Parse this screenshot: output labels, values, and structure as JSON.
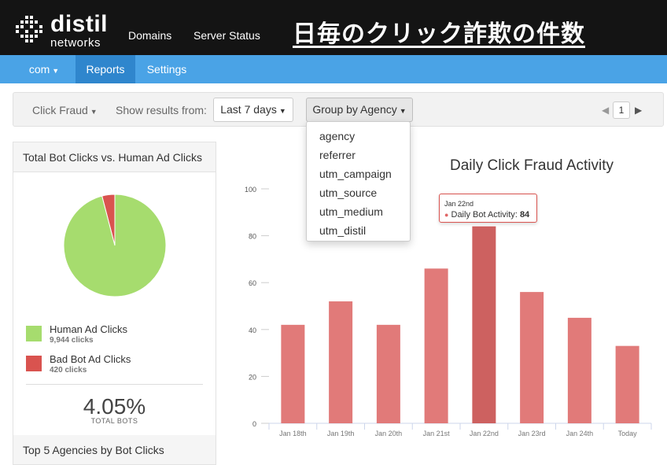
{
  "header": {
    "logo_word": "distil",
    "logo_sub": "networks",
    "nav": [
      "Domains",
      "Server Status"
    ],
    "overlay_title": "日毎のクリック詐欺の件数"
  },
  "subnav": {
    "domain": "com",
    "tabs": [
      "Reports",
      "Settings"
    ],
    "active": "Reports"
  },
  "filters": {
    "report": "Click Fraud",
    "show_results_label": "Show results from:",
    "range": "Last 7 days",
    "group_by": "Group by Agency",
    "page": "1"
  },
  "group_menu": {
    "options": [
      "agency",
      "referrer",
      "utm_campaign",
      "utm_source",
      "utm_medium",
      "utm_distil"
    ]
  },
  "left_panel": {
    "title": "Total Bot Clicks vs. Human Ad Clicks",
    "legend": [
      {
        "label": "Human Ad Clicks",
        "sub": "9,944 clicks",
        "color": "#a6dc6e"
      },
      {
        "label": "Bad Bot Ad Clicks",
        "sub": "420 clicks",
        "color": "#d9534f"
      }
    ],
    "percent": "4.05%",
    "percent_label": "TOTAL BOTS",
    "agencies_title": "Top 5 Agencies by Bot Clicks"
  },
  "pie_data": {
    "type": "pie",
    "slices": [
      {
        "name": "Human Ad Clicks",
        "value": 9944,
        "color": "#a6dc6e"
      },
      {
        "name": "Bad Bot Ad Clicks",
        "value": 420,
        "color": "#d9534f"
      }
    ]
  },
  "chart_data": {
    "type": "bar",
    "title": "Daily Click Fraud Activity",
    "categories": [
      "Jan 18th",
      "Jan 19th",
      "Jan 20th",
      "Jan 21st",
      "Jan 22nd",
      "Jan 23rd",
      "Jan 24th",
      "Today"
    ],
    "series": [
      {
        "name": "Daily Bot Activity",
        "values": [
          42,
          52,
          42,
          66,
          84,
          56,
          45,
          33
        ]
      }
    ],
    "ylim": [
      0,
      100
    ],
    "yticks": [
      0,
      20,
      40,
      60,
      80,
      100
    ],
    "bar_color": "#e17a79",
    "highlight_color": "#cd6160",
    "highlight_index": 4,
    "tooltip": {
      "date": "Jan 22nd",
      "series": "Daily Bot Activity",
      "value": "84"
    }
  }
}
